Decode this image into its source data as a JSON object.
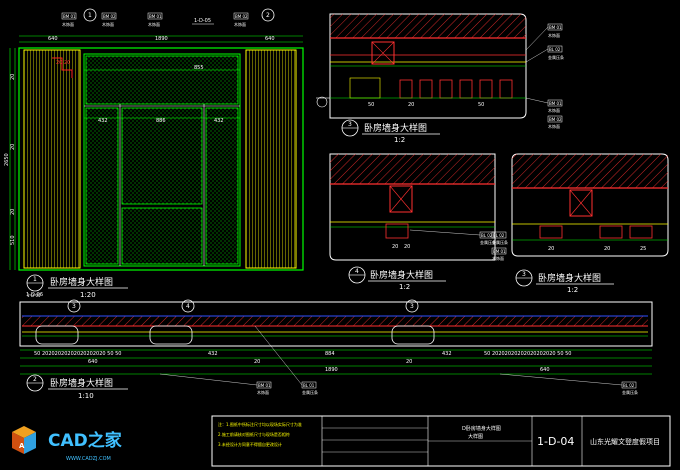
{
  "sheet": {
    "colors": {
      "background": "#000000",
      "frame": "#e8e8e8",
      "green": "#00ff00",
      "yellow": "#ffff00",
      "red": "#ff2020",
      "cyan": "#00ffff",
      "hatch_yellow": "#c8c800",
      "hatch_green": "#00a000",
      "blue_line": "#3050ff"
    }
  },
  "elevation": {
    "dims_top": [
      "640",
      "640",
      "1890"
    ],
    "dims_mid": [
      "432",
      "886",
      "432",
      "855"
    ],
    "dim_height": "2650",
    "dim_left_sub": "510",
    "dims_left_small": [
      "20",
      "20",
      "20"
    ],
    "marker_top_center": "1-D-05",
    "callout_top": [
      "1",
      "2"
    ],
    "tags": [
      {
        "code": "BM 01",
        "name": "木饰面"
      },
      {
        "code": "BM 02",
        "name": "木饰面"
      },
      {
        "code": "BM 01",
        "name": "木饰面"
      },
      {
        "code": "BM 02",
        "name": "木饰面"
      }
    ],
    "title": {
      "num": "1",
      "text": "卧房墙身大样图",
      "scale": "1:20",
      "sheet": "1-D-05"
    }
  },
  "detail3_top": {
    "dims": [
      "50",
      "20",
      "50"
    ],
    "tags": [
      {
        "code": "BM 01",
        "name": "木饰面"
      },
      {
        "code": "BL 02",
        "name": "金属压条"
      },
      {
        "code": "BM 01",
        "name": "木饰面"
      },
      {
        "code": "BM 02",
        "name": "木饰面"
      }
    ],
    "title": {
      "num": "3",
      "text": "卧房墙身大样图",
      "scale": "1:2"
    }
  },
  "detail4": {
    "dims": [
      "20",
      "20"
    ],
    "tags": [
      {
        "code": "BL 02",
        "name": "金属压条"
      }
    ],
    "title": {
      "num": "4",
      "text": "卧房墙身大样图",
      "scale": "1:2"
    }
  },
  "detail3_right": {
    "dims": [
      "20",
      "20",
      "25"
    ],
    "tags": [
      {
        "code": "BL 02",
        "name": "金属压条"
      },
      {
        "code": "BM 01",
        "name": "木饰面"
      }
    ],
    "title": {
      "num": "3",
      "text": "卧房墙身大样图",
      "scale": "1:2"
    }
  },
  "plan": {
    "sheet_ref": "1-D-06",
    "dims_row": "50 20202020202020202020 50 50",
    "dim_432": "432",
    "dim_884": "884",
    "dim_20": "20",
    "dim_640": "640",
    "dim_1890": "1890",
    "callouts": [
      "3",
      "4",
      "3"
    ],
    "tags": [
      {
        "code": "BM 01",
        "name": "木饰面"
      },
      {
        "code": "BL 01",
        "name": "金属压条"
      },
      {
        "code": "BL 02",
        "name": "金属压条"
      }
    ],
    "title": {
      "num": "2",
      "text": "卧房墙身大样图",
      "scale": "1:10"
    }
  },
  "title_block": {
    "notes": [
      "注：1.图纸中所标注尺寸均以现场实际尺寸为准",
      "2.施工前请核对图纸尺寸与现场是否相符",
      "3.未经设计方同意不得擅自更改设计"
    ],
    "drawing_label": "D卧房墙身大样图",
    "drawing_sub": "大样图",
    "sheet_no": "1-D-04",
    "project": "山东光耀文登度假项目"
  },
  "watermark": {
    "brand": "CAD之家",
    "url": "WWW.CADZJ.COM"
  }
}
